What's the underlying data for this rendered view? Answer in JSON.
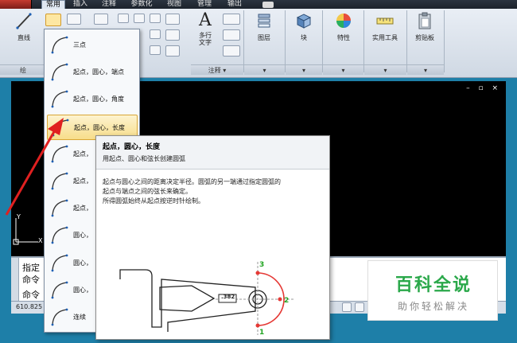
{
  "menubar": {
    "tabs": [
      "常用",
      "插入",
      "注释",
      "参数化",
      "视图",
      "管理",
      "输出"
    ],
    "active": "常用"
  },
  "ribbon": {
    "draw_panel_label": "绘",
    "line_label": "直线",
    "mtext_label": "多行\n文字",
    "annotation_panel_label": "注释",
    "layers_label": "图层",
    "block_label": "块",
    "properties_label": "特性",
    "utilities_label": "实用工具",
    "clipboard_label": "剪贴板"
  },
  "arc_dropdown": {
    "items": [
      {
        "label": "三点",
        "selected": false
      },
      {
        "label": "起点，圆心，端点",
        "selected": false
      },
      {
        "label": "起点，圆心，角度",
        "selected": false
      },
      {
        "label": "起点，圆心，长度",
        "selected": true
      },
      {
        "label": "起点，",
        "selected": false
      },
      {
        "label": "起点，",
        "selected": false
      },
      {
        "label": "起点，",
        "selected": false
      },
      {
        "label": "圆心，",
        "selected": false
      },
      {
        "label": "圆心，",
        "selected": false
      },
      {
        "label": "圆心，",
        "selected": false
      },
      {
        "label": "连续",
        "selected": false
      }
    ]
  },
  "tooltip": {
    "title": "起点，圆心，长度",
    "subtitle": "用起点、圆心和弦长创建圆弧",
    "desc_lines": [
      "起点与圆心之间的距离决定半径。圆弧的另一端通过指定圆弧的",
      "起点与端点之间的弦长来确定。",
      "所得圆弧始终从起点按逆时针绘制。"
    ],
    "dimension_value": ".382",
    "point_labels": [
      "3",
      "2",
      "1"
    ]
  },
  "commandline": {
    "line1": "指定",
    "line2": "命令",
    "line3": "命令"
  },
  "statusbar": {
    "coords": "610.825"
  },
  "drawing": {
    "ucs_y": "Y",
    "ucs_x": "X",
    "window_controls": "– ▫ ×"
  },
  "watermark": {
    "title": "百科全说",
    "subtitle": "助你轻松解决"
  },
  "colors": {
    "arrow": "#e02020",
    "arc": "#e53935",
    "green_label": "#21a421",
    "watermark_green": "#2aa84a"
  }
}
